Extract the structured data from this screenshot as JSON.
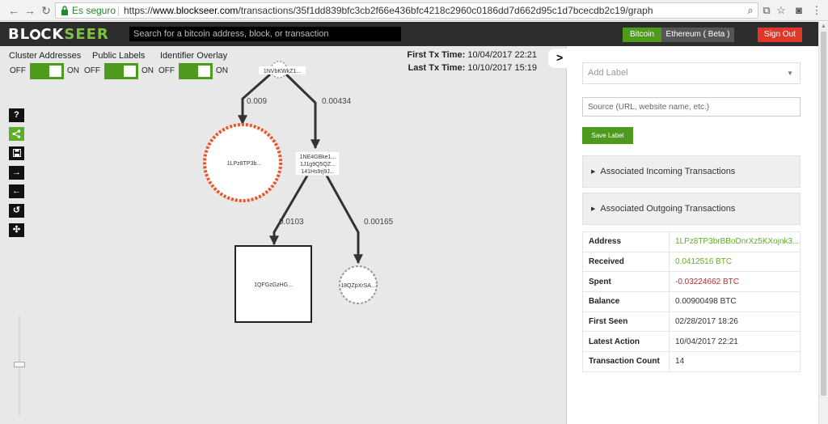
{
  "browser": {
    "secure_text": "Es seguro",
    "url_scheme": "https://",
    "url_host": "www.blockseer.com",
    "url_path": "/transactions/35f1dd839bfc3cb2f66e436bfc4218c2960c0186dd7d662d95c1d7bcecdb2c19/graph"
  },
  "header": {
    "logo_part1": "BL",
    "logo_part2": "CK",
    "logo_part3": "SEER",
    "search_placeholder": "Search for a bitcoin address, block, or transaction",
    "bitcoin_label": "Bitcoin",
    "ethereum_label": "Ethereum ( Beta )",
    "signout_label": "Sign Out"
  },
  "controls": {
    "toggles": [
      {
        "label": "Cluster Addresses",
        "off": "OFF",
        "on": "ON"
      },
      {
        "label": "Public Labels",
        "off": "OFF",
        "on": "ON"
      },
      {
        "label": "Identifier Overlay",
        "off": "OFF",
        "on": "ON"
      }
    ],
    "first_tx_label": "First Tx Time:",
    "first_tx_value": "10/04/2017 22:21",
    "last_tx_label": "Last Tx Time:",
    "last_tx_value": "10/10/2017 15:19"
  },
  "toolbar": {
    "help": "?",
    "share": "<",
    "save": "▣",
    "next": "→",
    "prev": "←",
    "reset": "↺",
    "fullscreen": "✣"
  },
  "graph": {
    "root_label": "1NVbKWkZ1...",
    "left_circle_label": "1LPz8TP3b...",
    "middle_line1": "1NE4GBke1...",
    "middle_line2": "1J1g9Q5QZ...",
    "middle_line3": "141Hs9rj9J...",
    "square_label": "1QFGzGzHG...",
    "small_circle_label": "18QZpXrSA...",
    "edge_root_left": "0.009",
    "edge_root_middle": "0.00434",
    "edge_middle_square": "0.0103",
    "edge_middle_small": "0.00165"
  },
  "panel": {
    "collapse": ">",
    "add_label_placeholder": "Add Label",
    "source_placeholder": "Source (URL, website name, etc.)",
    "save_label": "Save Label",
    "incoming": "Associated Incoming Transactions",
    "outgoing": "Associated Outgoing Transactions",
    "rows": [
      {
        "key": "Address",
        "value": "1LPz8TP3brBBoDnrXz5KXojnk3..."
      },
      {
        "key": "Received",
        "value": "0.0412516 BTC"
      },
      {
        "key": "Spent",
        "value": "-0.03224662 BTC"
      },
      {
        "key": "Balance",
        "value": "0.00900498 BTC"
      },
      {
        "key": "First Seen",
        "value": "02/28/2017 18:26"
      },
      {
        "key": "Latest Action",
        "value": "10/04/2017 22:21"
      },
      {
        "key": "Transaction Count",
        "value": "14"
      }
    ]
  },
  "colors": {
    "accent_green": "#4e9a1c",
    "signout_red": "#e0372a",
    "orange_node": "#e8562a"
  }
}
